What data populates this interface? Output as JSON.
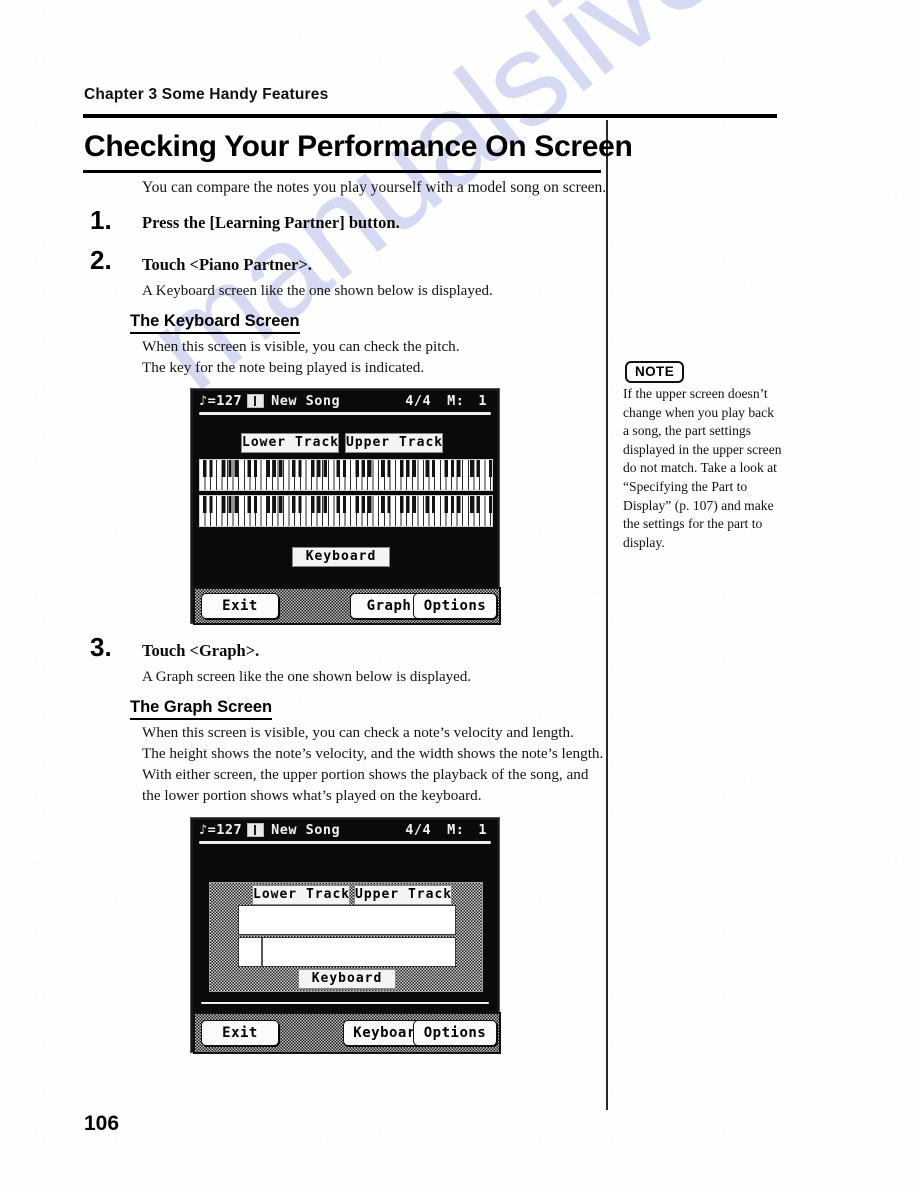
{
  "header": {
    "chapter": "Chapter 3 Some Handy Features",
    "title": "Checking Your Performance On Screen"
  },
  "watermark": "manualslive.com",
  "intro": "You can compare the notes you play yourself with a model song on screen.",
  "steps": [
    {
      "number": "1.",
      "title": "Press the [Learning Partner] button.",
      "sub": ""
    },
    {
      "number": "2.",
      "title": "Touch <Piano Partner>.",
      "sub": "A Keyboard screen like the one shown below is displayed."
    },
    {
      "number": "3.",
      "title": "Touch <Graph>.",
      "sub": "A Graph screen like the one shown below is displayed."
    }
  ],
  "keyboard_section": {
    "heading": "The Keyboard Screen",
    "line1": "When this screen is visible, you can check the pitch.",
    "line2": "The key for the note being played is indicated."
  },
  "graph_section": {
    "heading": "The Graph Screen",
    "line1": "When this screen is visible, you can check a note’s velocity and length.",
    "line2": "The height shows the note’s velocity, and the width shows the note’s length.",
    "line3": "With either screen, the upper portion shows the playback of the song, and",
    "line4": "the lower portion shows what’s played on the keyboard."
  },
  "note": {
    "badge": "NOTE",
    "body": "If the upper screen doesn’t change when you play back a song, the part settings displayed in the upper screen do not match. Take a look at “Specifying the Part to Display” (p. 107) and make the settings for the part to display."
  },
  "lcd_keyboard": {
    "tempo": "♪=127",
    "icon": "song-book-icon",
    "song": "New Song",
    "time_signature": "4/4",
    "measure_label": "M:",
    "measure_value": "1",
    "tab_lower": "Lower Track",
    "tab_upper": "Upper Track",
    "tab_keyboard": "Keyboard",
    "buttons": [
      "Exit",
      "Graph",
      "Options"
    ]
  },
  "lcd_graph": {
    "tempo": "♪=127",
    "icon": "song-book-icon",
    "song": "New Song",
    "time_signature": "4/4",
    "measure_label": "M:",
    "measure_value": "1",
    "tab_lower": "Lower Track",
    "tab_upper": "Upper Track",
    "tab_keyboard": "Keyboard",
    "buttons": [
      "Exit",
      "Keyboard",
      "Options"
    ]
  },
  "folio": "106"
}
